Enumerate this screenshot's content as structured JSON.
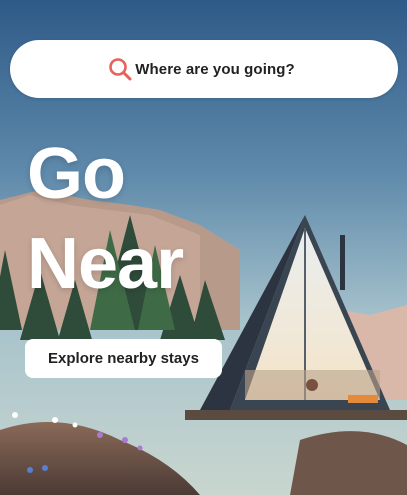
{
  "search": {
    "label": "Where are you going?",
    "icon": "search-icon",
    "icon_color": "#e8615a"
  },
  "hero": {
    "headline_line1": "Go",
    "headline_line2": "Near",
    "cta_label": "Explore nearby stays",
    "image": "a-frame-cabin-mountain-illustration"
  },
  "colors": {
    "sky_top": "#2f5d8c",
    "sky_bottom": "#a9c4cf",
    "accent": "#e8615a",
    "text_dark": "#222222"
  }
}
